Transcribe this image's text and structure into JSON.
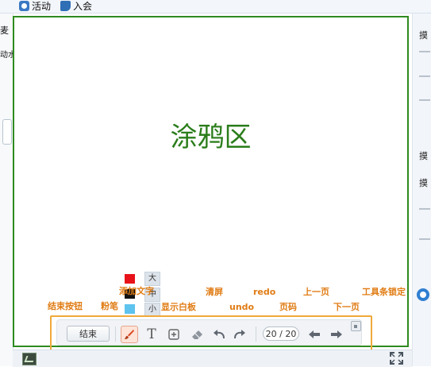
{
  "topbar": {
    "items": [
      {
        "label": "活动",
        "icon": "activity-icon"
      },
      {
        "label": "入会",
        "icon": "join-meeting-icon"
      }
    ]
  },
  "left_panel": {
    "fragment_1": "麦",
    "fragment_2": "动水"
  },
  "right_panel": {
    "fragment_1": "摸",
    "fragment_2": "摸",
    "fragment_3": "摸"
  },
  "whiteboard": {
    "title": "涂鸦区"
  },
  "annotations": {
    "end_button": "结束按钮",
    "brush": "粉笔",
    "add_text": "添加文字",
    "show_whiteboard": "显示白板",
    "clear": "清屏",
    "undo": "undo",
    "redo": "redo",
    "page_number": "页码",
    "prev_page": "上一页",
    "next_page": "下一页",
    "lock_toolbar": "工具条锁定"
  },
  "palette": {
    "colors": [
      "#e8121a",
      "#111111",
      "#5ec3ee"
    ],
    "sizes": [
      "大",
      "中",
      "小"
    ]
  },
  "toolbar": {
    "end_label": "结束",
    "text_tool_glyph": "T",
    "page_indicator": "20 / 20"
  }
}
